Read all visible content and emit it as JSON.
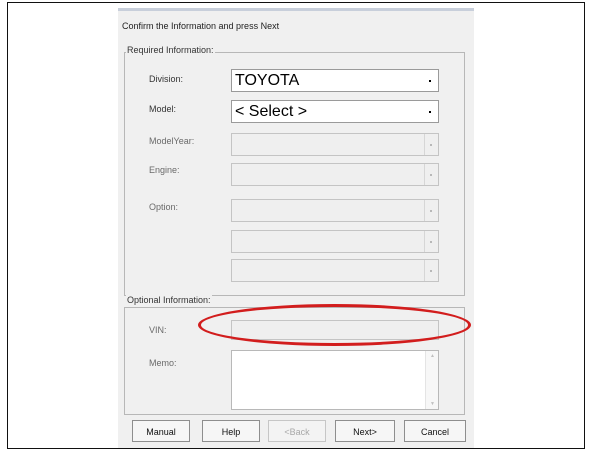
{
  "dialog": {
    "title": "Confirm the Information and press Next"
  },
  "required": {
    "group_label": "Required Information:",
    "division": {
      "label": "Division:",
      "value": "TOYOTA"
    },
    "model": {
      "label": "Model:",
      "value": "< Select >"
    },
    "model_year": {
      "label": "ModelYear:",
      "value": ""
    },
    "engine": {
      "label": "Engine:",
      "value": ""
    },
    "option": {
      "label": "Option:",
      "values": [
        "",
        "",
        ""
      ]
    }
  },
  "optional": {
    "group_label": "Optional Information:",
    "vin": {
      "label": "VIN:",
      "value": ""
    },
    "memo": {
      "label": "Memo:",
      "value": ""
    }
  },
  "buttons": {
    "manual": "Manual",
    "help": "Help",
    "back": "<Back",
    "next": "Next>",
    "cancel": "Cancel"
  },
  "annotation": {
    "color": "#d21d1d",
    "shape": "ellipse"
  },
  "colors": {
    "dialog_bg": "#f0f0f0",
    "highlight": "#d21d1d"
  }
}
